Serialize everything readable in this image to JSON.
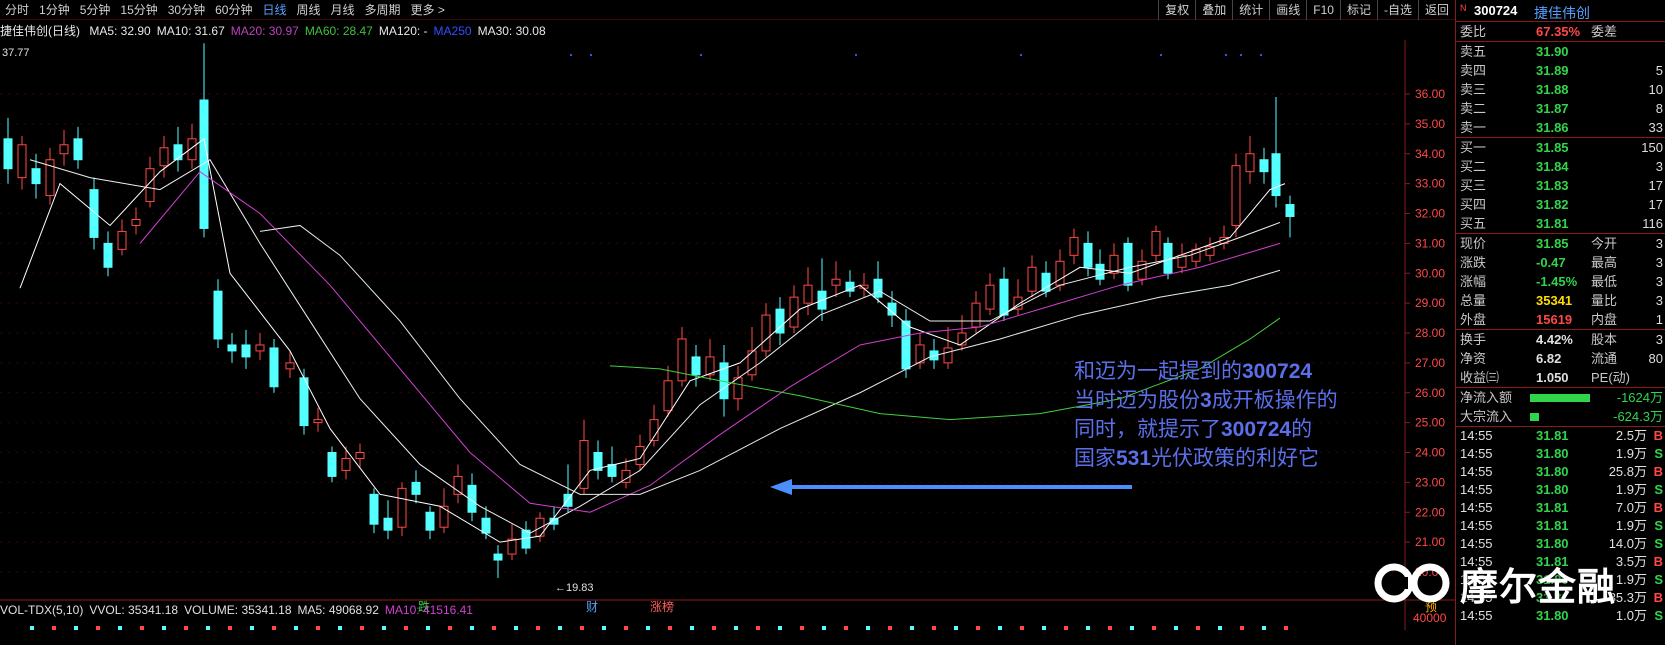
{
  "toolbar": {
    "periods": [
      "分时",
      "1分钟",
      "5分钟",
      "15分钟",
      "30分钟",
      "60分钟",
      "日线",
      "周线",
      "月线",
      "多周期",
      "更多 >"
    ],
    "active_period": "日线",
    "tools": [
      "复权",
      "叠加",
      "统计",
      "画线",
      "F10",
      "标记",
      "-自选",
      "返回"
    ]
  },
  "ma_legend": {
    "name": "捷佳伟创(日线)",
    "items": [
      {
        "label": "MA5: 32.90",
        "color": "#e8e8e8"
      },
      {
        "label": "MA10: 31.67",
        "color": "#e8e8e8"
      },
      {
        "label": "MA20: 30.97",
        "color": "#c040c0"
      },
      {
        "label": "MA60: 28.47",
        "color": "#40c040"
      },
      {
        "label": "MA120: -",
        "color": "#e8e8e8"
      },
      {
        "label": "MA250",
        "color": "#3050ff"
      },
      {
        "label": "MA30: 30.08",
        "color": "#e8e8e8"
      }
    ]
  },
  "chart": {
    "high_marker": "37.77",
    "low_marker": "←19.83",
    "event_labels": [
      {
        "text": "跌",
        "color": "#31d54b"
      },
      {
        "text": "财",
        "color": "#55a0ff"
      },
      {
        "text": "涨榜",
        "color": "#ff6060"
      },
      {
        "text": "预",
        "color": "#ffaa00"
      }
    ],
    "price_ticks": [
      "36.00",
      "35.00",
      "34.00",
      "33.00",
      "32.00",
      "31.00",
      "30.00",
      "29.00",
      "28.00",
      "27.00",
      "26.00",
      "25.00",
      "24.00",
      "23.00",
      "22.00",
      "21.00",
      "20.00"
    ],
    "vol_tick": "40000",
    "colors": {
      "up": "#ff4848",
      "down": "#54ffff",
      "ma5": "#ffffff",
      "ma10": "#e0e040",
      "ma20": "#d040d0",
      "ma60": "#40d040",
      "grid": "#5a0000"
    }
  },
  "annotation": {
    "line1_a": "和迈为一起提到的",
    "line1_b": "300724",
    "line2_a": "当时迈为股份",
    "line2_b": "3",
    "line2_c": "成开板操作的",
    "line3_a": "同时，就提示了",
    "line3_b": "300724",
    "line3_c": "的",
    "line4_a": "国家",
    "line4_b": "531",
    "line4_c": "光伏政策的利好它"
  },
  "volume_legend": {
    "items": [
      {
        "label": "VOL-TDX(5,10)",
        "color": "#e0e0e0"
      },
      {
        "label": "VVOL: 35341.18",
        "color": "#e0e0e0"
      },
      {
        "label": "VOLUME: 35341.18",
        "color": "#e0e0e0"
      },
      {
        "label": "MA5: 49068.92",
        "color": "#e0e0e0"
      },
      {
        "label": "MA10: 41516.41",
        "color": "#d040d0"
      }
    ]
  },
  "panel": {
    "code": "300724",
    "name": "捷佳伟创",
    "wei_bi_label": "委比",
    "wei_bi_value": "67.35%",
    "wei_cha_label": "委差",
    "sell": [
      {
        "label": "卖五",
        "price": "31.90",
        "vol": ""
      },
      {
        "label": "卖四",
        "price": "31.89",
        "vol": "5"
      },
      {
        "label": "卖三",
        "price": "31.88",
        "vol": "10"
      },
      {
        "label": "卖二",
        "price": "31.87",
        "vol": "8"
      },
      {
        "label": "卖一",
        "price": "31.86",
        "vol": "33"
      }
    ],
    "buy": [
      {
        "label": "买一",
        "price": "31.85",
        "vol": "150"
      },
      {
        "label": "买二",
        "price": "31.84",
        "vol": "3"
      },
      {
        "label": "买三",
        "price": "31.83",
        "vol": "17"
      },
      {
        "label": "买四",
        "price": "31.82",
        "vol": "17"
      },
      {
        "label": "买五",
        "price": "31.81",
        "vol": "116"
      }
    ],
    "stats": [
      {
        "l1": "现价",
        "v1": "31.85",
        "c1": "green",
        "l2": "今开",
        "v2": "3"
      },
      {
        "l1": "涨跌",
        "v1": "-0.47",
        "c1": "green",
        "l2": "最高",
        "v2": "3"
      },
      {
        "l1": "涨幅",
        "v1": "-1.45%",
        "c1": "green",
        "l2": "最低",
        "v2": "3"
      },
      {
        "l1": "总量",
        "v1": "35341",
        "c1": "yellow",
        "l2": "量比",
        "v2": "3"
      },
      {
        "l1": "外盘",
        "v1": "15619",
        "c1": "red",
        "l2": "内盘",
        "v2": "1"
      }
    ],
    "stats2": [
      {
        "l1": "换手",
        "v1": "4.42%",
        "c1": "white",
        "l2": "股本",
        "v2": "3"
      },
      {
        "l1": "净资",
        "v1": "6.82",
        "c1": "white",
        "l2": "流通",
        "v2": "80"
      },
      {
        "l1": "收益㈢",
        "v1": "1.050",
        "c1": "white",
        "l2": "PE(动)",
        "v2": ""
      }
    ],
    "flow": [
      {
        "label": "净流入额",
        "bar": 0.68,
        "value": "-1624万"
      },
      {
        "label": "大宗流入",
        "bar": 0.1,
        "value": "-624.3万"
      }
    ],
    "ticks": [
      {
        "time": "14:55",
        "price": "31.81",
        "vol": "2.5万",
        "side": "B"
      },
      {
        "time": "14:55",
        "price": "31.80",
        "vol": "1.9万",
        "side": "S"
      },
      {
        "time": "14:55",
        "price": "31.80",
        "vol": "25.8万",
        "side": "B"
      },
      {
        "time": "14:55",
        "price": "31.80",
        "vol": "1.9万",
        "side": "S"
      },
      {
        "time": "14:55",
        "price": "31.81",
        "vol": "7.0万",
        "side": "B"
      },
      {
        "time": "14:55",
        "price": "31.81",
        "vol": "1.9万",
        "side": "S"
      },
      {
        "time": "14:55",
        "price": "31.80",
        "vol": "14.0万",
        "side": "S"
      },
      {
        "time": "14:55",
        "price": "31.81",
        "vol": "3.5万",
        "side": "B"
      },
      {
        "time": "14:55",
        "price": "31.80",
        "vol": "1.9万",
        "side": "S"
      },
      {
        "time": "14:55",
        "price": "31.81",
        "vol": "35.3万",
        "side": "B"
      },
      {
        "time": "14:55",
        "price": "31.80",
        "vol": "1.0万",
        "side": "S"
      }
    ]
  },
  "watermark": {
    "text": "摩尔金融"
  }
}
